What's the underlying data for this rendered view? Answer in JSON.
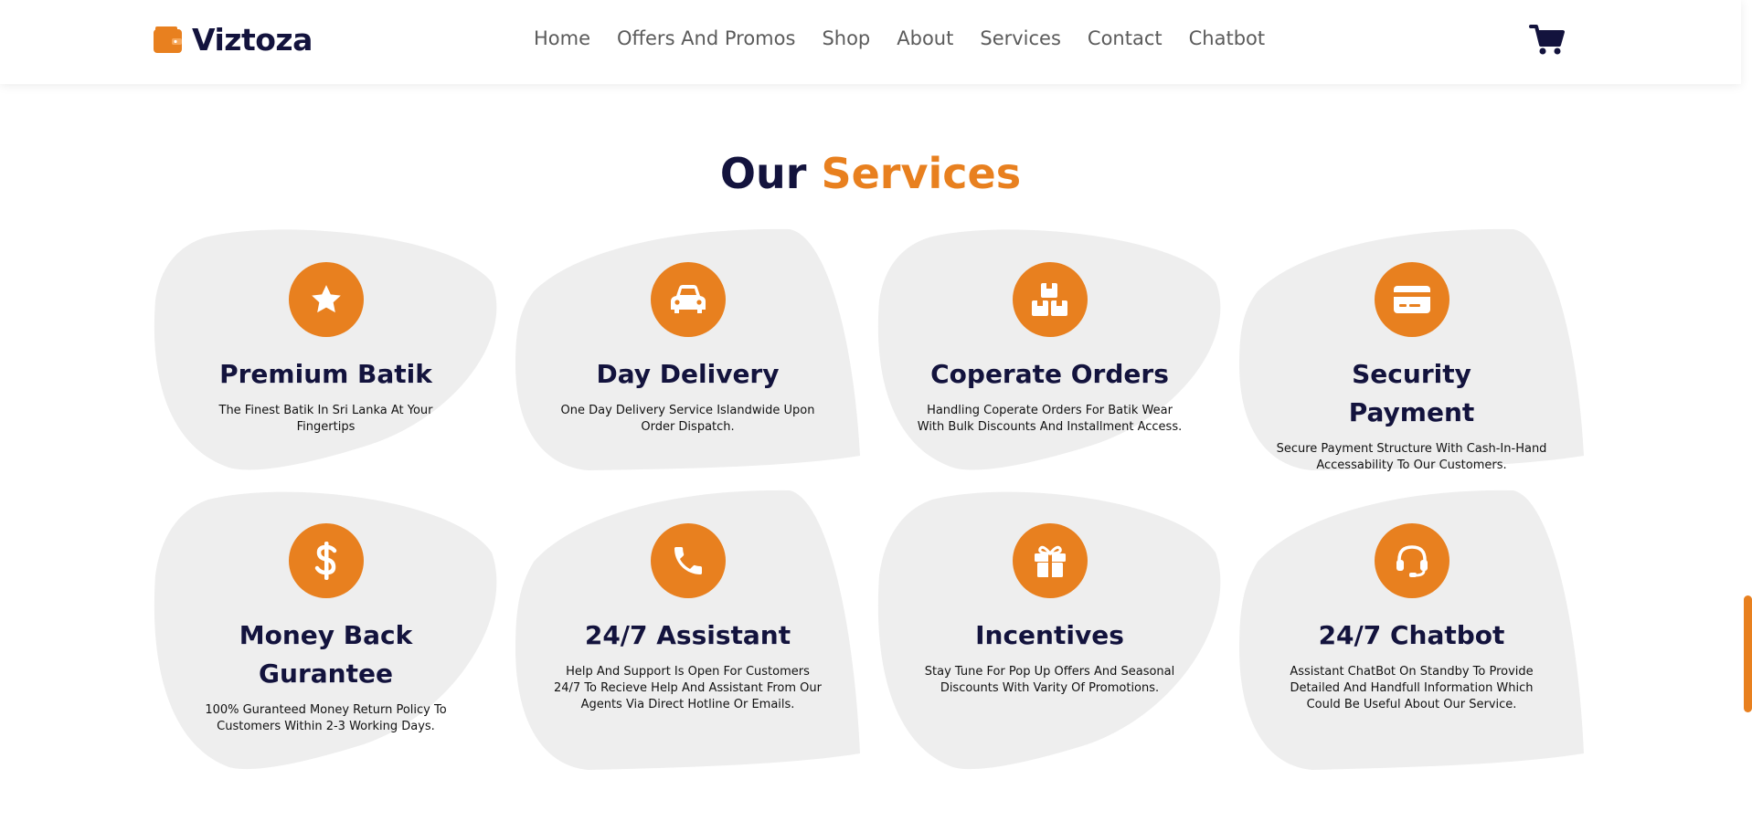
{
  "brand": {
    "name": "Viztoza",
    "accent": "#e8801f",
    "dark": "#13133d"
  },
  "nav": [
    "Home",
    "Offers And Promos",
    "Shop",
    "About",
    "Services",
    "Contact",
    "Chatbot"
  ],
  "cart_icon": "cart-icon",
  "section": {
    "title_part1": "Our",
    "title_part2": "Services"
  },
  "services": [
    {
      "icon": "star-icon",
      "title": "Premium Batik",
      "desc": "The Finest Batik In Sri Lanka At Your Fingertips"
    },
    {
      "icon": "car-icon",
      "title": "Day Delivery",
      "desc": "One Day Delivery Service Islandwide Upon Order Dispatch."
    },
    {
      "icon": "boxes-icon",
      "title": "Coperate Orders",
      "desc": "Handling Coperate Orders For Batik Wear With Bulk Discounts And Installment Access."
    },
    {
      "icon": "credit-card-icon",
      "title": "Security Payment",
      "desc": "Secure Payment Structure With Cash-In-Hand Accessability To Our Customers."
    },
    {
      "icon": "dollar-icon",
      "title": "Money Back Gurantee",
      "desc": "100% Guranteed Money Return Policy To Customers Within 2-3 Working Days."
    },
    {
      "icon": "phone-icon",
      "title": "24/7 Assistant",
      "desc": "Help And Support Is Open For Customers 24/7 To Recieve Help And Assistant From Our Agents Via Direct Hotline Or Emails."
    },
    {
      "icon": "gift-icon",
      "title": "Incentives",
      "desc": "Stay Tune For Pop Up Offers And Seasonal Discounts With Varity Of Promotions."
    },
    {
      "icon": "headset-icon",
      "title": "24/7 Chatbot",
      "desc": "Assistant ChatBot On Standby To Provide Detailed And Handfull Information Which Could Be Useful About Our Service."
    }
  ]
}
